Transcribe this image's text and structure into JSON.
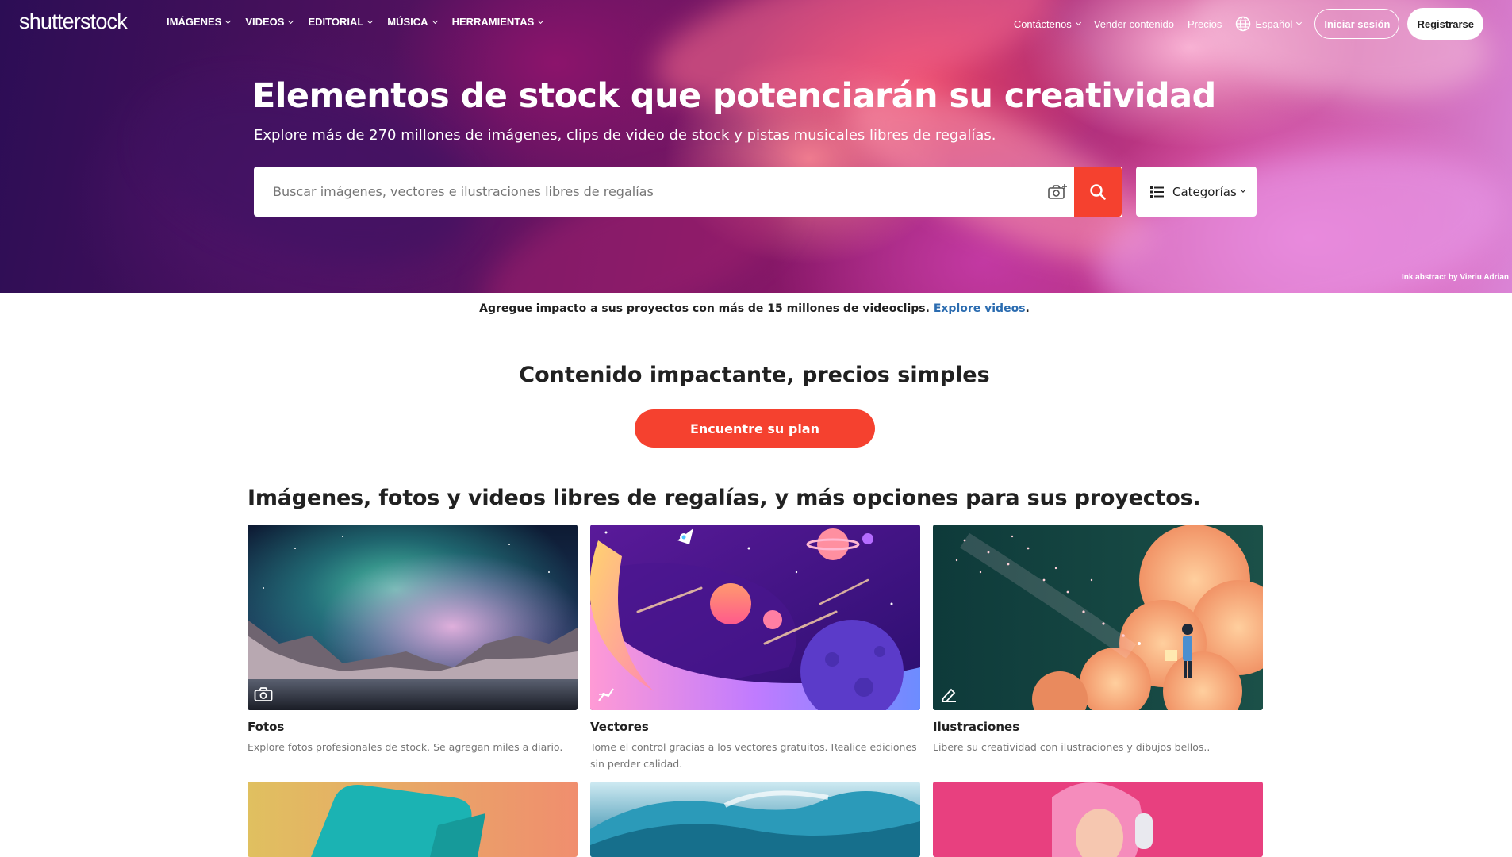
{
  "brand": {
    "logo_text": "shutterstock",
    "accent_color": "#f5412f"
  },
  "header": {
    "nav": [
      "IMÁGENES",
      "VIDEOS",
      "EDITORIAL",
      "MÚSICA",
      "HERRAMIENTAS"
    ],
    "contact": "Contáctenos",
    "sell": "Vender contenido",
    "pricing": "Precios",
    "language": "Español",
    "login": "Iniciar sesión",
    "register": "Registrarse"
  },
  "hero": {
    "title": "Elementos de stock que potenciarán su creatividad",
    "subtitle": "Explore más de 270 millones de imágenes, clips de video de stock y pistas musicales libres de regalías.",
    "search_placeholder": "Buscar imágenes, vectores e ilustraciones libres de regalías",
    "categories_label": "Categorías",
    "image_credit": "Ink abstract by Vieriu Adrian"
  },
  "promo": {
    "text": "Agregue impacto a sus proyectos con más de 15 millones de videoclips.",
    "link": "Explore videos",
    "suffix": "."
  },
  "plan": {
    "title": "Contenido impactante, precios simples",
    "button": "Encuentre su plan"
  },
  "catalog": {
    "title": "Imágenes, fotos y videos libres de regalías, y más opciones para sus proyectos.",
    "cards": [
      {
        "label": "Fotos",
        "desc": "Explore fotos profesionales de stock. Se agregan miles a diario.",
        "icon": "camera-icon"
      },
      {
        "label": "Vectores",
        "desc": "Tome el control gracias a los vectores gratuitos. Realice ediciones sin perder calidad.",
        "icon": "vector-pen-icon"
      },
      {
        "label": "Ilustraciones",
        "desc": "Libere su creatividad con ilustraciones y dibujos bellos..",
        "icon": "pencil-icon"
      }
    ]
  }
}
